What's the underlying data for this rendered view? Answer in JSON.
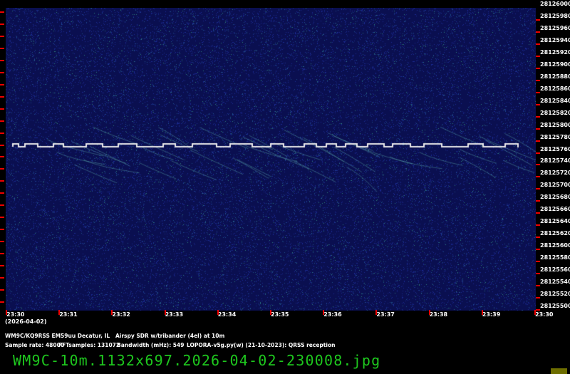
{
  "y_axis": {
    "labels": [
      "28126000",
      "28125980",
      "28125960",
      "28125940",
      "28125920",
      "28125900",
      "28125880",
      "28125860",
      "28125840",
      "28125820",
      "28125800",
      "28125780",
      "28125760",
      "28125740",
      "28125720",
      "28125700",
      "28125680",
      "28125660",
      "28125640",
      "28125620",
      "28125600",
      "28125580",
      "28125560",
      "28125540",
      "28125520",
      "28125500"
    ]
  },
  "x_axis": {
    "labels": [
      "23:30",
      "23:31",
      "23:32",
      "23:33",
      "23:34",
      "23:35",
      "23:36",
      "23:37",
      "23:38",
      "23:39",
      "23:30"
    ],
    "date": "(2026-04-02)"
  },
  "info": {
    "line1": "WM9C/KQ9RSS EM59uu Decatur, IL   Airspy SDR w/tribander (4el) at 10m",
    "sample_rate": "Sample rate: 48000",
    "fft": "FFTsamples: 131072",
    "bandwidth": "Bandwidth (mHz): 549",
    "software": "LOPORA-v5g.py(w) (21-10-2023): QRSS reception"
  },
  "filename": "WM9C-10m.1132x697.2026-04-02-230008.jpg",
  "colors": {
    "background": "#000000",
    "waterfall": "#0a0f5a",
    "tick": "#e00000",
    "filename": "#1ec81e"
  }
}
